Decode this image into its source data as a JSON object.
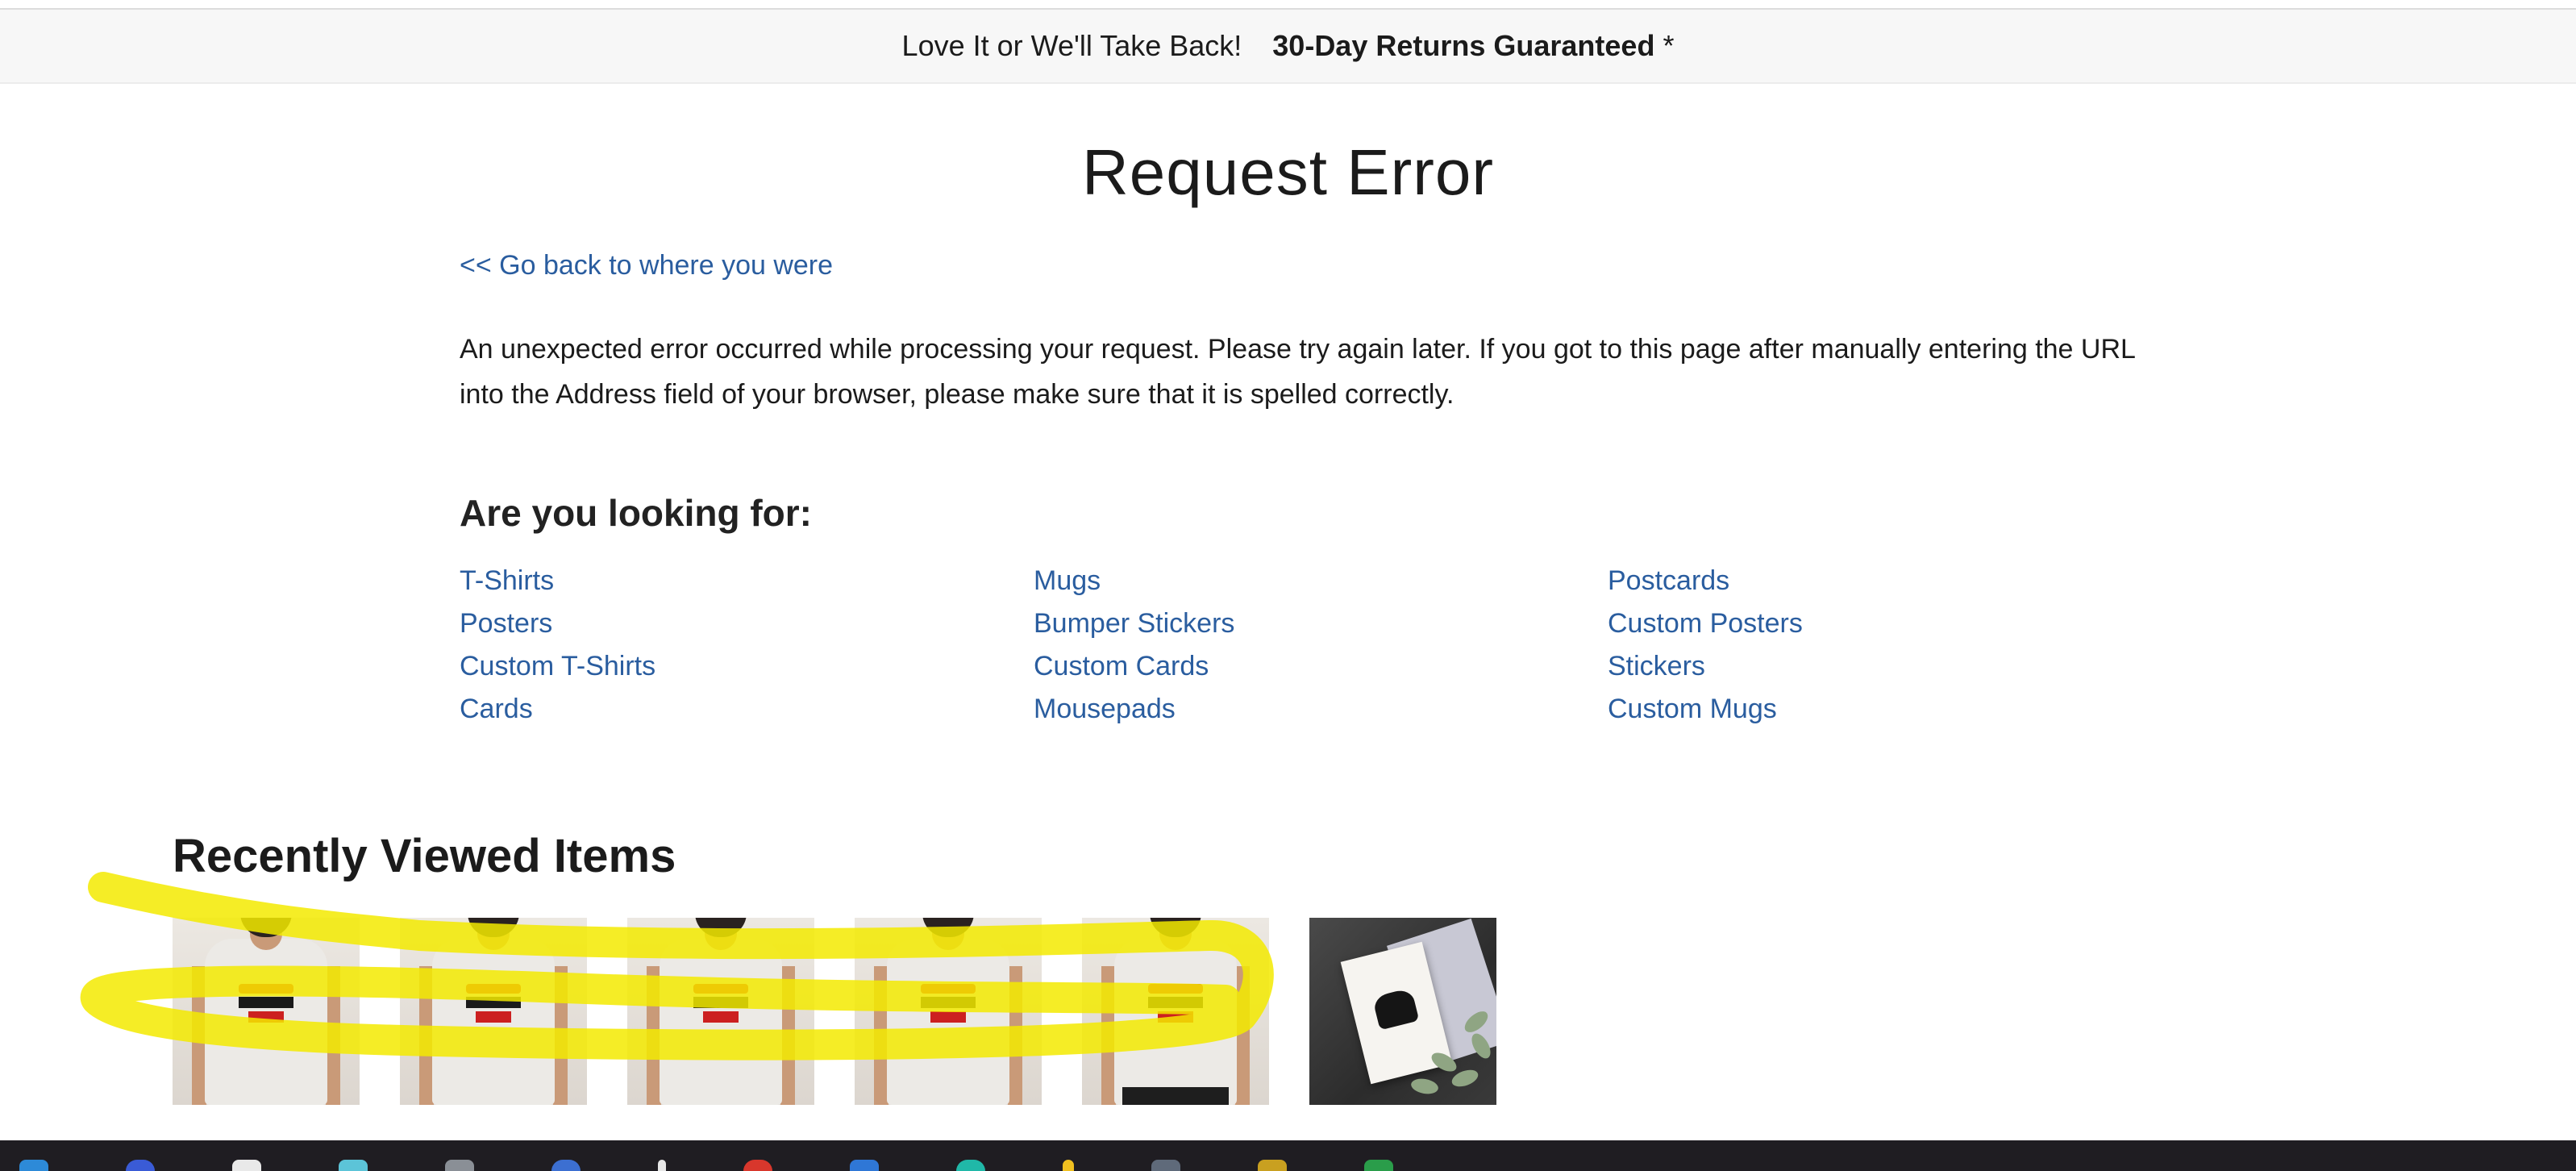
{
  "promo": {
    "text": "Love It or We'll Take Back!",
    "bold": "30-Day Returns Guaranteed",
    "star": "*"
  },
  "page_title": "Request Error",
  "back_link": "<< Go back to where you were",
  "error_message": "An unexpected error occurred while processing your request. Please try again later. If you got to this page after manually entering the URL into the Address field of your browser, please make sure that it is spelled correctly.",
  "looking": {
    "title": "Are you looking for:",
    "links": [
      "T-Shirts",
      "Mugs",
      "Postcards",
      "Posters",
      "Bumper Stickers",
      "Custom Posters",
      "Custom T-Shirts",
      "Custom Cards",
      "Stickers",
      "Cards",
      "Mousepads",
      "Custom Mugs"
    ]
  },
  "recent": {
    "title": "Recently Viewed Items"
  },
  "colors": {
    "link": "#2a5d9f",
    "highlight": "#f3ea00",
    "promo_bg": "#f7f7f7",
    "taskbar": "#1f1d22"
  },
  "taskbar_icons": [
    "windows-icon",
    "browser-icon",
    "file-icon",
    "app-icon",
    "app-icon",
    "app-icon",
    "app-icon",
    "app-icon",
    "app-icon",
    "app-icon",
    "app-icon",
    "app-icon",
    "app-icon",
    "app-icon",
    "app-icon",
    "app-icon"
  ]
}
